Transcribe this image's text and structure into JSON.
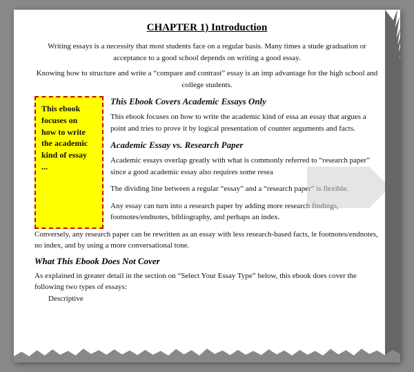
{
  "page": {
    "chapter_title": "CHAPTER 1) Introduction",
    "intro_para1": "Writing essays is a necessity that most students face on a regular basis. Many times a stude graduation or acceptance to a good school depends on writing a good essay.",
    "intro_para2": "Knowing how to structure and write a “compare and contrast” essay is an imp advantage for the high school and college students.",
    "yellow_box": {
      "line1": "This ebook",
      "line2": "focuses on",
      "line3": "how to write",
      "line4": "the academic",
      "line5": "kind of essay",
      "line6": "..."
    },
    "section1_heading": "This Ebook Covers Academic Essays Only",
    "section1_text": "This ebook focuses on how to write the academic kind of essa an essay that argues a point and tries to prove it by logical presentation of counter arguments and facts.",
    "section2_heading": "Academic Essay vs. Research Paper",
    "section2_text1": "Academic essays overlap greatly with what is commonly referred to “research paper” since a good academic essay also requires some resea",
    "section2_text2": "The dividing line between a regular “essay” and a “research paper” is flexible.",
    "section2_text3": "Any essay can turn into a research paper by adding more research findings, footnotes/endnotes, bibliography, and perhaps an index.",
    "full_text1": "Conversely, any research paper can be rewritten as an essay with less research-based facts, le footnotes/endnotes, no index, and by using a more conversational tone.",
    "section3_heading": "What This Ebook Does Not Cover",
    "section3_text": "As explained in greater detail in the section on “Select Your Essay Type” below, this ebook does cover the following two types of essays:",
    "list_item1": "Descriptive"
  }
}
